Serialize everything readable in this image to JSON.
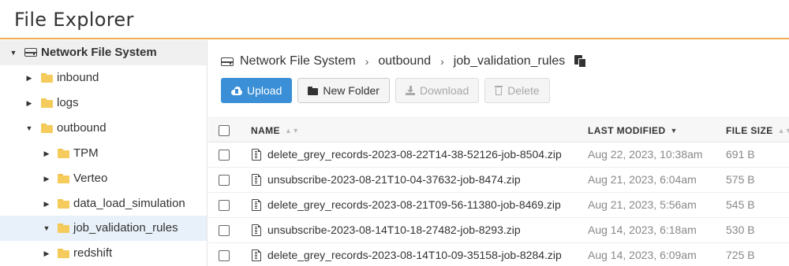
{
  "app": {
    "title": "File Explorer"
  },
  "sidebar": {
    "items": [
      {
        "label": "Network File System",
        "level": 0,
        "expanded": true,
        "icon": "drive-icon"
      },
      {
        "label": "inbound",
        "level": 1,
        "expanded": false,
        "icon": "folder-icon"
      },
      {
        "label": "logs",
        "level": 1,
        "expanded": false,
        "icon": "folder-icon"
      },
      {
        "label": "outbound",
        "level": 1,
        "expanded": true,
        "icon": "folder-icon"
      },
      {
        "label": "TPM",
        "level": 2,
        "expanded": false,
        "icon": "folder-icon"
      },
      {
        "label": "Verteo",
        "level": 2,
        "expanded": false,
        "icon": "folder-icon"
      },
      {
        "label": "data_load_simulation",
        "level": 2,
        "expanded": false,
        "icon": "folder-icon"
      },
      {
        "label": "job_validation_rules",
        "level": 2,
        "expanded": true,
        "selected": true,
        "icon": "folder-icon"
      },
      {
        "label": "redshift",
        "level": 2,
        "expanded": false,
        "icon": "folder-icon"
      }
    ]
  },
  "breadcrumb": {
    "items": [
      "Network File System",
      "outbound",
      "job_validation_rules"
    ],
    "separator": "›"
  },
  "toolbar": {
    "upload_label": "Upload",
    "new_folder_label": "New Folder",
    "download_label": "Download",
    "delete_label": "Delete"
  },
  "table": {
    "columns": {
      "name": "NAME",
      "modified": "LAST MODIFIED",
      "size": "FILE SIZE"
    },
    "sorted_by": "LAST MODIFIED",
    "sort_direction": "descending",
    "rows": [
      {
        "name": "delete_grey_records-2023-08-22T14-38-52126-job-8504.zip",
        "modified": "Aug 22, 2023, 10:38am",
        "size": "691 B"
      },
      {
        "name": "unsubscribe-2023-08-21T10-04-37632-job-8474.zip",
        "modified": "Aug 21, 2023, 6:04am",
        "size": "575 B"
      },
      {
        "name": "delete_grey_records-2023-08-21T09-56-11380-job-8469.zip",
        "modified": "Aug 21, 2023, 5:56am",
        "size": "545 B"
      },
      {
        "name": "unsubscribe-2023-08-14T10-18-27482-job-8293.zip",
        "modified": "Aug 14, 2023, 6:18am",
        "size": "530 B"
      },
      {
        "name": "delete_grey_records-2023-08-14T10-09-35158-job-8284.zip",
        "modified": "Aug 14, 2023, 6:09am",
        "size": "725 B"
      }
    ]
  },
  "colors": {
    "accent": "#f0ad4e",
    "primary": "#3a8fd6",
    "folder": "#f5cb5c",
    "selected": "#e8f0f9"
  }
}
